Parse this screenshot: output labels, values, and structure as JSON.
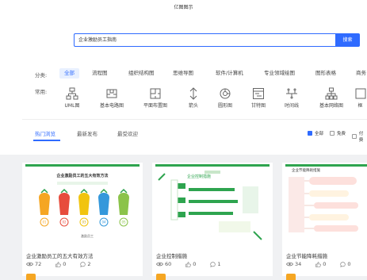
{
  "header": {
    "title": "亿图图示"
  },
  "search": {
    "value": "企业激励员工指南",
    "button": "搜索"
  },
  "categories": {
    "label": "分类:",
    "items": [
      "全部",
      "流程图",
      "组织结构图",
      "思维导图",
      "软件/计算机",
      "专业领域绘图",
      "图形表格",
      "商务"
    ]
  },
  "common": {
    "label": "常用:",
    "items": [
      "UML图",
      "基本电路图",
      "平面布置图",
      "箭头",
      "圆形图",
      "甘特图",
      "时间线",
      "基本网络图",
      "框"
    ]
  },
  "tabs": {
    "items": [
      "热门浏览",
      "最新发布",
      "最受欢迎"
    ],
    "active": 0
  },
  "filters": {
    "all": "全部",
    "free": "免费",
    "paid": "付费"
  },
  "cards": [
    {
      "title": "企业激励员工的五大有效方法",
      "views": "72",
      "likes": "0",
      "comments": "2",
      "thumb": {
        "heading": "企业激励员工的五大有效方法",
        "nums": [
          "01",
          "02",
          "03",
          "04",
          "05"
        ],
        "footer": "激励员工"
      }
    },
    {
      "title": "企业控制措施",
      "views": "60",
      "likes": "0",
      "comments": "1",
      "thumb": {
        "heading": "企业控制措施"
      }
    },
    {
      "title": "企业节能降耗措施",
      "views": "34",
      "likes": "0",
      "comments": "0",
      "thumb": {
        "heading": "企业节能降耗措施"
      }
    }
  ],
  "colors": {
    "accent": "#2f6bff",
    "green": "#2ea44f",
    "orange": "#f5a623"
  }
}
